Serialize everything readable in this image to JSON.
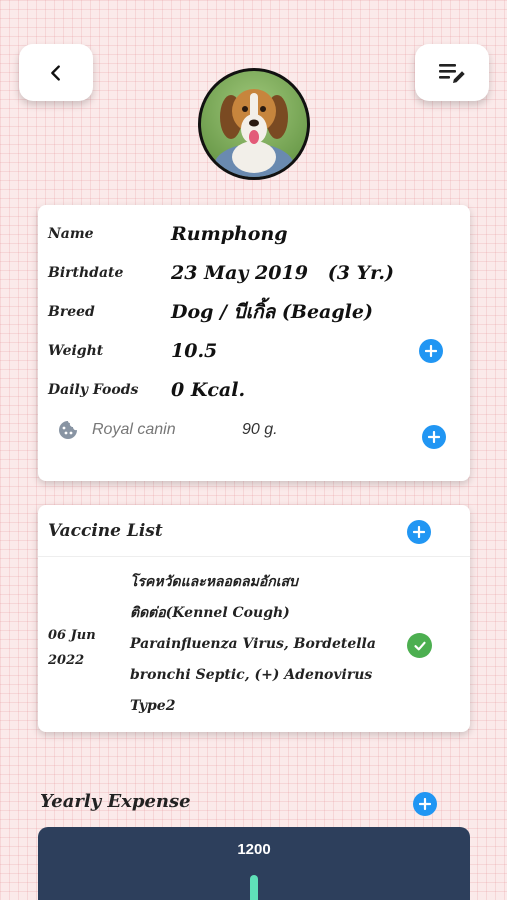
{
  "header": {
    "back_icon": "chevron-left-icon",
    "edit_icon": "list-edit-icon"
  },
  "pet": {
    "avatar": "beagle-photo",
    "fields": {
      "name_label": "Name",
      "name_value": "Rumphong",
      "birth_label": "Birthdate",
      "birth_value": "23 May 2019   (3 Yr.)",
      "breed_label": "Breed",
      "breed_value": "Dog / บีเกิ้ล (Beagle)",
      "weight_label": "Weight",
      "weight_value": "10.5",
      "foods_label": "Daily Foods",
      "foods_value": "0 Kcal."
    },
    "food_item": {
      "name": "Royal canin",
      "amount": "90 g.",
      "icon": "cookie-icon"
    }
  },
  "vaccine": {
    "title": "Vaccine List",
    "items": [
      {
        "date": "06 Jun 2022",
        "description": "โรคหวัดและหลอดลมอักเสบติดต่อ(Kennel Cough) Parainfluenza Virus, Bordetella bronchi Septic, (+) Adenovirus Type2",
        "status_icon": "check-circle-icon"
      }
    ]
  },
  "expense": {
    "title": "Yearly Expense"
  },
  "chart_data": {
    "type": "bar",
    "categories": [
      ""
    ],
    "values": [
      1200
    ],
    "data_labels": [
      "1200"
    ]
  },
  "colors": {
    "accent": "#2196f3",
    "success": "#4caf50",
    "chart_bg": "#2d3f5c",
    "bar": "#5fe0b8"
  }
}
